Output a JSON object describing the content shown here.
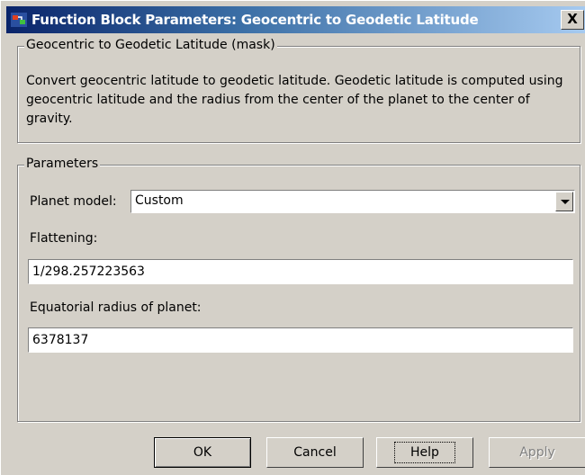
{
  "window": {
    "title": "Function Block Parameters: Geocentric to Geodetic Latitude",
    "close_glyph": "X",
    "title_gradient": [
      "#0a246a",
      "#a6caf0"
    ],
    "app_icon": "simulink-block-icon"
  },
  "mask_group": {
    "legend": "Geocentric to Geodetic Latitude (mask)",
    "description": "Convert geocentric latitude to geodetic latitude.  Geodetic latitude is computed using geocentric latitude and the radius from the center of the planet to the center of gravity."
  },
  "parameters_group": {
    "legend": "Parameters",
    "planet_model": {
      "label": "Planet model:",
      "value": "Custom"
    },
    "flattening": {
      "label": "Flattening:",
      "value": "1/298.257223563"
    },
    "equatorial_radius": {
      "label": "Equatorial radius of planet:",
      "value": "6378137"
    }
  },
  "buttons": {
    "ok": "OK",
    "cancel": "Cancel",
    "help": "Help",
    "apply": "Apply"
  }
}
